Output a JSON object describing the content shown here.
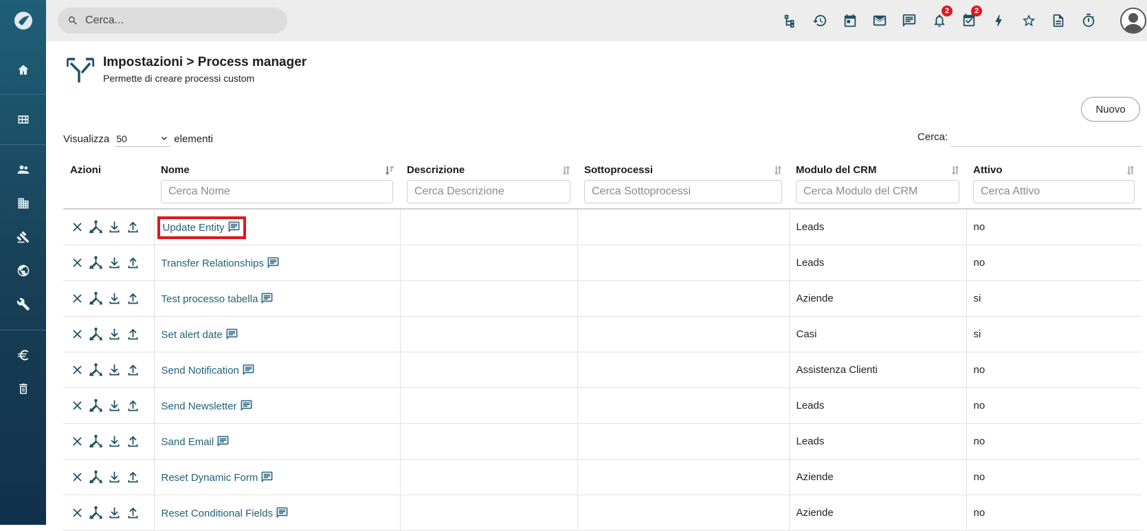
{
  "search": {
    "placeholder": "Cerca..."
  },
  "notifications": {
    "bell_count": "2",
    "tasks_count": "2"
  },
  "header": {
    "title": "Impostazioni > Process manager",
    "subtitle": "Permette di creare processi custom"
  },
  "toolbar": {
    "new_label": "Nuovo"
  },
  "length": {
    "prefix": "Visualizza",
    "value": "50",
    "suffix": "elementi"
  },
  "filter": {
    "label": "Cerca:"
  },
  "table": {
    "columns": [
      {
        "label": "Azioni"
      },
      {
        "label": "Nome",
        "placeholder": "Cerca Nome"
      },
      {
        "label": "Descrizione",
        "placeholder": "Cerca Descrizione"
      },
      {
        "label": "Sottoprocessi",
        "placeholder": "Cerca Sottoprocessi"
      },
      {
        "label": "Modulo del CRM",
        "placeholder": "Cerca Modulo del CRM"
      },
      {
        "label": "Attivo",
        "placeholder": "Cerca Attivo"
      }
    ],
    "rows": [
      {
        "name": "Update Entity",
        "description": "",
        "subprocesses": "",
        "module": "Leads",
        "active": "no"
      },
      {
        "name": "Transfer Relationships",
        "description": "",
        "subprocesses": "",
        "module": "Leads",
        "active": "no"
      },
      {
        "name": "Test processo tabella",
        "description": "",
        "subprocesses": "",
        "module": "Aziende",
        "active": "si"
      },
      {
        "name": "Set alert date",
        "description": "",
        "subprocesses": "",
        "module": "Casi",
        "active": "si"
      },
      {
        "name": "Send Notification",
        "description": "",
        "subprocesses": "",
        "module": "Assistenza Clienti",
        "active": "no"
      },
      {
        "name": "Send Newsletter",
        "description": "",
        "subprocesses": "",
        "module": "Leads",
        "active": "no"
      },
      {
        "name": "Sand Email",
        "description": "",
        "subprocesses": "",
        "module": "Leads",
        "active": "no"
      },
      {
        "name": "Reset Dynamic Form",
        "description": "",
        "subprocesses": "",
        "module": "Aziende",
        "active": "no"
      },
      {
        "name": "Reset Conditional Fields",
        "description": "",
        "subprocesses": "",
        "module": "Aziende",
        "active": "no"
      }
    ]
  },
  "colors": {
    "sidebar": "#1f5f78",
    "accent": "#1e4f63",
    "link": "#22617a",
    "badge": "#e3161f",
    "highlight": "#e0171d"
  }
}
